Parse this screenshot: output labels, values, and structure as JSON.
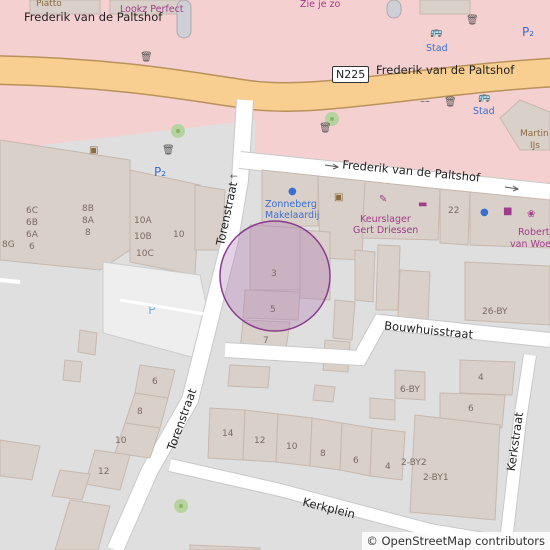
{
  "streets": {
    "frederik_top": "Frederik van de Paltshof",
    "frederik_main": "Frederik van de Paltshof",
    "frederik_lower": "Frederik van de Paltshof",
    "torenstraat_north": "Torenstraat",
    "torenstraat_south": "Torenstraat",
    "bouwhuisstraat": "Bouwhuisstraat",
    "kerkstraat": "Kerkstraat",
    "kerkplein": "Kerkplein"
  },
  "route_shield": "N225",
  "pois": {
    "piatto": "Piatto",
    "lookz": "Lookz Perfect",
    "zie_je_zo": "Zie je zo",
    "stad_1": "Stad",
    "stad_2": "Stad",
    "martin_ijs_1": "Martin",
    "martin_ijs_2": "IJs",
    "zonneberg_1": "Zonneberg",
    "zonneberg_2": "Makelaardij",
    "keurslager_1": "Keurslager",
    "keurslager_2": "Gert Driessen",
    "robert_1": "Robert",
    "robert_2": "van Woerek"
  },
  "house_numbers": {
    "n6c": "6C",
    "n6b": "6B",
    "n6a": "6A",
    "n6": "6",
    "n8g": "8G",
    "n8b": "8B",
    "n8a": "8A",
    "n8": "8",
    "n10a": "10A",
    "n10b": "10B",
    "n10c": "10C",
    "n10": "10",
    "n22": "22",
    "n3": "3",
    "n5": "5",
    "n7": "7",
    "n26by": "26-BY",
    "n6by": "6-BY",
    "n4r": "4",
    "n6r": "6",
    "n6w": "6",
    "n8w": "8",
    "n10w": "10",
    "n12w": "12",
    "n14k": "14",
    "n12k": "12",
    "n10k": "10",
    "n8k": "8",
    "n6k": "6",
    "n4k": "4",
    "n2by2": "2-BY2",
    "n2by1": "2-BY1"
  },
  "attribution": {
    "copyright": "©",
    "text": "OpenStreetMap contributors"
  },
  "icons": [
    "bicycle-parking-icon",
    "waste-basket-icon",
    "bus-stop-icon",
    "bench-icon",
    "parking-icon",
    "tree-icon",
    "shop-icon"
  ],
  "colors": {
    "pedestrian": "#f5cfcf",
    "road_trunk": "#f9c78a",
    "building": "#d9d0c9",
    "landuse": "#e0dfdf",
    "parking": "#eeeeee",
    "marker_fill": "#b07ab5",
    "marker_stroke": "#8a3a8e"
  }
}
